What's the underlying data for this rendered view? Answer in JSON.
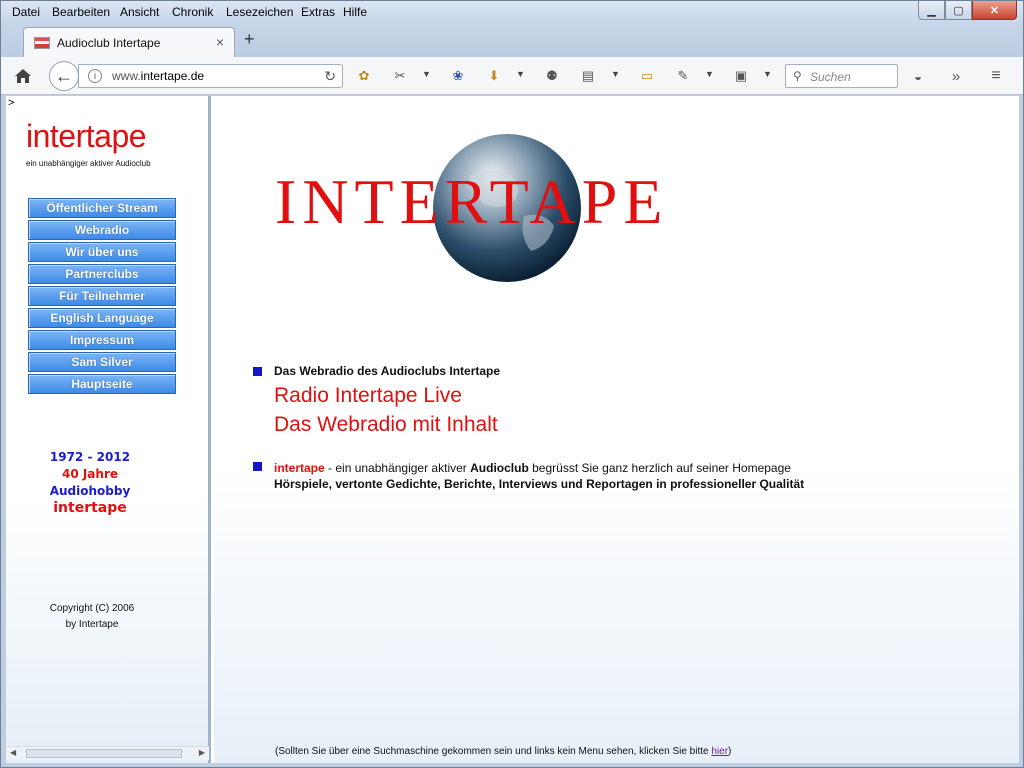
{
  "menu": [
    "Datei",
    "Bearbeiten",
    "Ansicht",
    "Chronik",
    "Lesezeichen",
    "Extras",
    "Hilfe"
  ],
  "tab": {
    "title": "Audioclub Intertape",
    "close": "×",
    "new": "+"
  },
  "url": {
    "prefix": "www.",
    "domain": "intertape.de"
  },
  "search": {
    "placeholder": "Suchen"
  },
  "sidebar": {
    "caret": ">",
    "logo": "intertape",
    "tagline": "ein unabhängiger aktiver Audioclub",
    "nav": [
      "Öffentlicher Stream",
      "Webradio",
      "Wir über uns",
      "Partnerclubs",
      "Für Teilnehmer",
      "English Language",
      "Impressum",
      "Sam Silver",
      "Hauptseite"
    ],
    "anniversary": {
      "years": "1972 - 2012",
      "jahre": "40 Jahre",
      "hobby": "Audiohobby",
      "name": "intertape"
    },
    "copyright_line1": "Copyright (C) 2006",
    "copyright_line2": "by Intertape"
  },
  "main": {
    "banner_text": "INTERTAPE",
    "section1_heading": "Das Webradio des Audioclubs Intertape",
    "radio_line1": "Radio Intertape Live",
    "radio_line2": "Das Webradio mit Inhalt",
    "welcome_brand": "intertape",
    "welcome_mid": " - ein unabhängiger aktiver ",
    "welcome_audioclub": "Audioclub",
    "welcome_end": " begrüsst Sie ganz herzlich auf seiner Homepage",
    "welcome_line2": "Hörspiele, vertonte Gedichte, Berichte, Interviews und Reportagen in professioneller Qualität",
    "footnote": "(Sollten Sie über eine Suchmaschine gekommen sein und links kein Menu sehen, klicken Sie bitte",
    "footnote_link": "hier",
    "footnote_end": ")"
  },
  "colors": {
    "brand_red": "#e01010",
    "bullet_blue": "#1515c8",
    "nav_blue": "#3d8ae8"
  }
}
